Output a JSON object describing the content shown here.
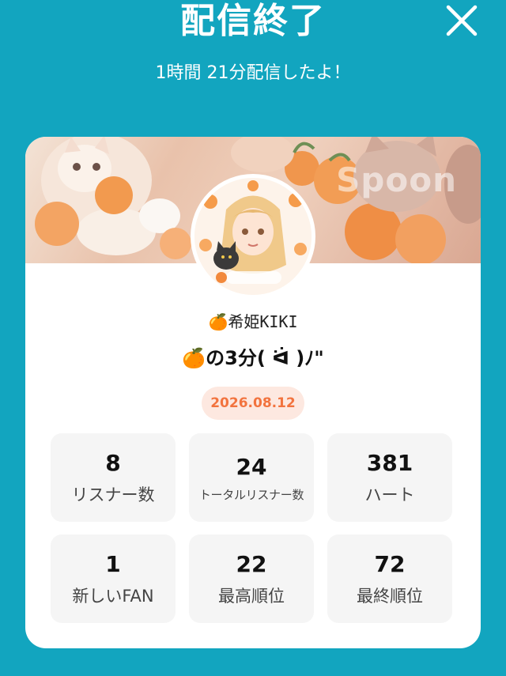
{
  "header": {
    "title": "配信終了",
    "subtitle": "1時間 21分配信したよ！"
  },
  "card": {
    "watermark": "Spoon",
    "username": "🍊希姫KIKI",
    "stream_title": "🍊の3分( ᐛ )ﾉ\"",
    "date": "2026.08.12"
  },
  "stats": [
    {
      "value": "8",
      "label": "リスナー数"
    },
    {
      "value": "24",
      "label": "トータルリスナー数"
    },
    {
      "value": "381",
      "label": "ハート"
    },
    {
      "value": "1",
      "label": "新しいFAN"
    },
    {
      "value": "22",
      "label": "最高順位"
    },
    {
      "value": "72",
      "label": "最終順位"
    }
  ],
  "colors": {
    "background": "#12a5bf",
    "date_badge_bg": "#fde8e0",
    "date_badge_text": "#f2733e"
  },
  "icons": {
    "close": "close-icon"
  }
}
